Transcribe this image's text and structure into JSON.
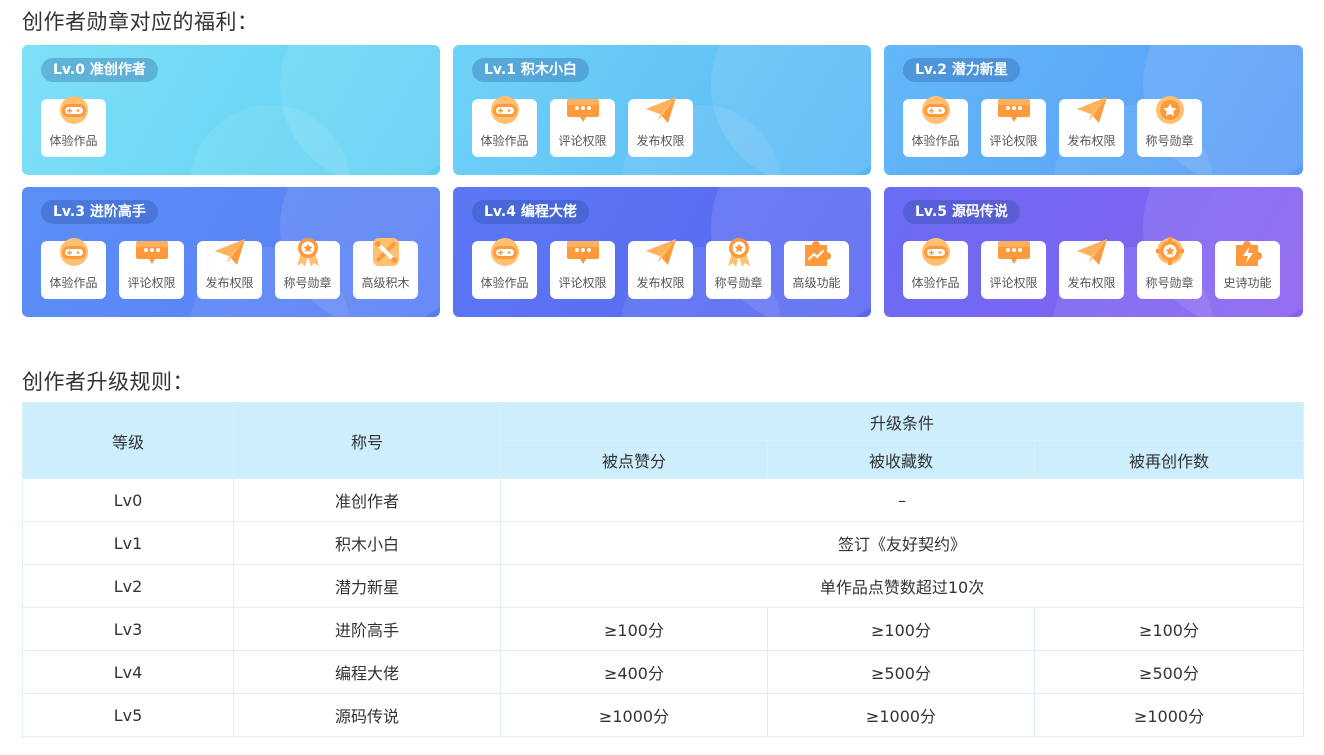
{
  "benefits_title": "创作者勋章对应的福利：",
  "rules_title": "创作者升级规则：",
  "levels": [
    {
      "badge": "Lv.0  准创作者",
      "perks": [
        {
          "label": "体验作品",
          "icon": "gamepad-icon"
        }
      ]
    },
    {
      "badge": "Lv.1  积木小白",
      "perks": [
        {
          "label": "体验作品",
          "icon": "gamepad-icon"
        },
        {
          "label": "评论权限",
          "icon": "chat-bubble-icon"
        },
        {
          "label": "发布权限",
          "icon": "paper-plane-icon"
        }
      ]
    },
    {
      "badge": "Lv.2  潜力新星",
      "perks": [
        {
          "label": "体验作品",
          "icon": "gamepad-icon"
        },
        {
          "label": "评论权限",
          "icon": "chat-bubble-icon"
        },
        {
          "label": "发布权限",
          "icon": "paper-plane-icon"
        },
        {
          "label": "称号勋章",
          "icon": "star-medal-icon"
        }
      ]
    },
    {
      "badge": "Lv.3  进阶高手",
      "perks": [
        {
          "label": "体验作品",
          "icon": "gamepad-icon"
        },
        {
          "label": "评论权限",
          "icon": "chat-bubble-icon"
        },
        {
          "label": "发布权限",
          "icon": "paper-plane-icon"
        },
        {
          "label": "称号勋章",
          "icon": "ribbon-medal-icon"
        },
        {
          "label": "高级积木",
          "icon": "tools-icon"
        }
      ]
    },
    {
      "badge": "Lv.4  编程大佬",
      "perks": [
        {
          "label": "体验作品",
          "icon": "gamepad-icon"
        },
        {
          "label": "评论权限",
          "icon": "chat-bubble-icon"
        },
        {
          "label": "发布权限",
          "icon": "paper-plane-icon"
        },
        {
          "label": "称号勋章",
          "icon": "ribbon-medal-icon"
        },
        {
          "label": "高级功能",
          "icon": "puzzle-icon"
        }
      ]
    },
    {
      "badge": "Lv.5  源码传说",
      "perks": [
        {
          "label": "体验作品",
          "icon": "gamepad-icon"
        },
        {
          "label": "评论权限",
          "icon": "chat-bubble-icon"
        },
        {
          "label": "发布权限",
          "icon": "paper-plane-icon"
        },
        {
          "label": "称号勋章",
          "icon": "gear-medal-icon"
        },
        {
          "label": "史诗功能",
          "icon": "puzzle-bolt-icon"
        }
      ]
    }
  ],
  "table": {
    "col_level": "等级",
    "col_title": "称号",
    "col_conditions": "升级条件",
    "col_likes": "被点赞分",
    "col_favs": "被收藏数",
    "col_remix": "被再创作数",
    "rows": [
      {
        "level": "Lv0",
        "title": "准创作者",
        "merged": "–"
      },
      {
        "level": "Lv1",
        "title": "积木小白",
        "merged": "签订《友好契约》"
      },
      {
        "level": "Lv2",
        "title": "潜力新星",
        "merged": "单作品点赞数超过10次"
      },
      {
        "level": "Lv3",
        "title": "进阶高手",
        "likes": "≥100分",
        "favs": "≥100分",
        "remix": "≥100分"
      },
      {
        "level": "Lv4",
        "title": "编程大佬",
        "likes": "≥400分",
        "favs": "≥500分",
        "remix": "≥500分"
      },
      {
        "level": "Lv5",
        "title": "源码传说",
        "likes": "≥1000分",
        "favs": "≥1000分",
        "remix": "≥1000分"
      }
    ]
  },
  "colors": {
    "icon_orange": "#ff9a3c",
    "icon_orange_light": "#ffc072",
    "header_bg": "#cdeefd"
  }
}
